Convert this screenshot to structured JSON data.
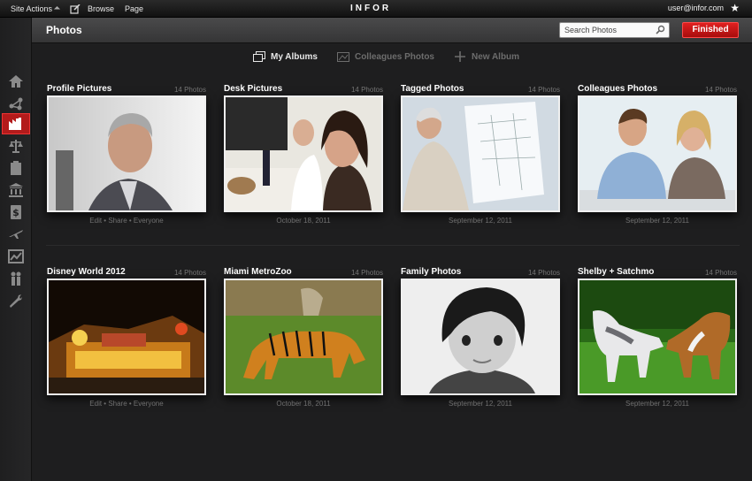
{
  "topbar": {
    "site_actions": "Site Actions",
    "browse": "Browse",
    "page": "Page",
    "logo": "INFOR",
    "user": "user@infor.com"
  },
  "header": {
    "title": "Photos",
    "search_placeholder": "Search Photos",
    "finished": "Finished"
  },
  "tabs": [
    {
      "label": "My Albums",
      "active": true,
      "icon": "albums-icon"
    },
    {
      "label": "Colleagues Photos",
      "active": false,
      "icon": "colleagues-photos-icon"
    },
    {
      "label": "New Album",
      "active": false,
      "icon": "plus-icon"
    }
  ],
  "sidebar": [
    {
      "icon": "home-icon"
    },
    {
      "icon": "share-network-icon"
    },
    {
      "icon": "factory-icon",
      "active": true
    },
    {
      "icon": "scales-icon"
    },
    {
      "icon": "clipboard-icon"
    },
    {
      "icon": "bank-icon"
    },
    {
      "icon": "dollar-icon"
    },
    {
      "icon": "airplane-icon"
    },
    {
      "icon": "chart-icon"
    },
    {
      "icon": "people-icon"
    },
    {
      "icon": "tools-icon"
    }
  ],
  "albums": [
    {
      "name": "Profile Pictures",
      "count": "14 Photos",
      "meta": "Edit  •  Share  •  Everyone"
    },
    {
      "name": "Desk Pictures",
      "count": "14 Photos",
      "meta": "October 18, 2011"
    },
    {
      "name": "Tagged Photos",
      "count": "14 Photos",
      "meta": "September 12, 2011"
    },
    {
      "name": "Colleagues Photos",
      "count": "14 Photos",
      "meta": "September 12, 2011"
    },
    {
      "name": "Disney World 2012",
      "count": "14 Photos",
      "meta": "Edit  •  Share  •  Everyone"
    },
    {
      "name": "Miami MetroZoo",
      "count": "14 Photos",
      "meta": "October 18, 2011"
    },
    {
      "name": "Family Photos",
      "count": "14 Photos",
      "meta": "September 12, 2011"
    },
    {
      "name": "Shelby + Satchmo",
      "count": "14 Photos",
      "meta": "September 12, 2011"
    }
  ]
}
